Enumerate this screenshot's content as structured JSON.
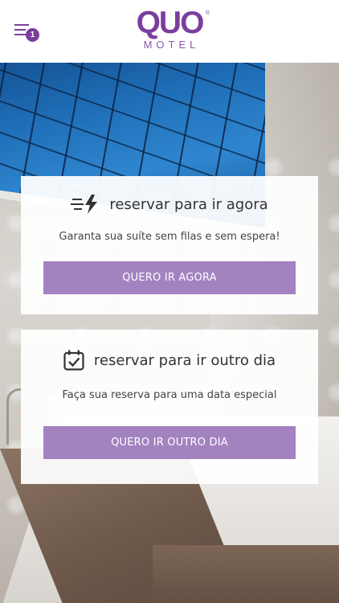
{
  "header": {
    "logo_text": "QUO",
    "logo_subtext": "MOTEL",
    "logo_mark": "®",
    "notification_count": "1",
    "icons": {
      "menu": "menu-icon"
    }
  },
  "cards": [
    {
      "title": "reservar para ir agora",
      "subtitle": "Garanta sua suíte sem filas e sem espera!",
      "button_label": "QUERO IR AGORA",
      "icon": "fast-lightning-icon"
    },
    {
      "title": "reservar para ir outro dia",
      "subtitle": "Faça sua reserva para uma data especial",
      "button_label": "QUERO IR OUTRO DIA",
      "icon": "calendar-check-icon"
    }
  ],
  "colors": {
    "brand_purple": "#7a3f9d",
    "button_purple": "#a382c0",
    "card_bg": "#ffffff"
  }
}
